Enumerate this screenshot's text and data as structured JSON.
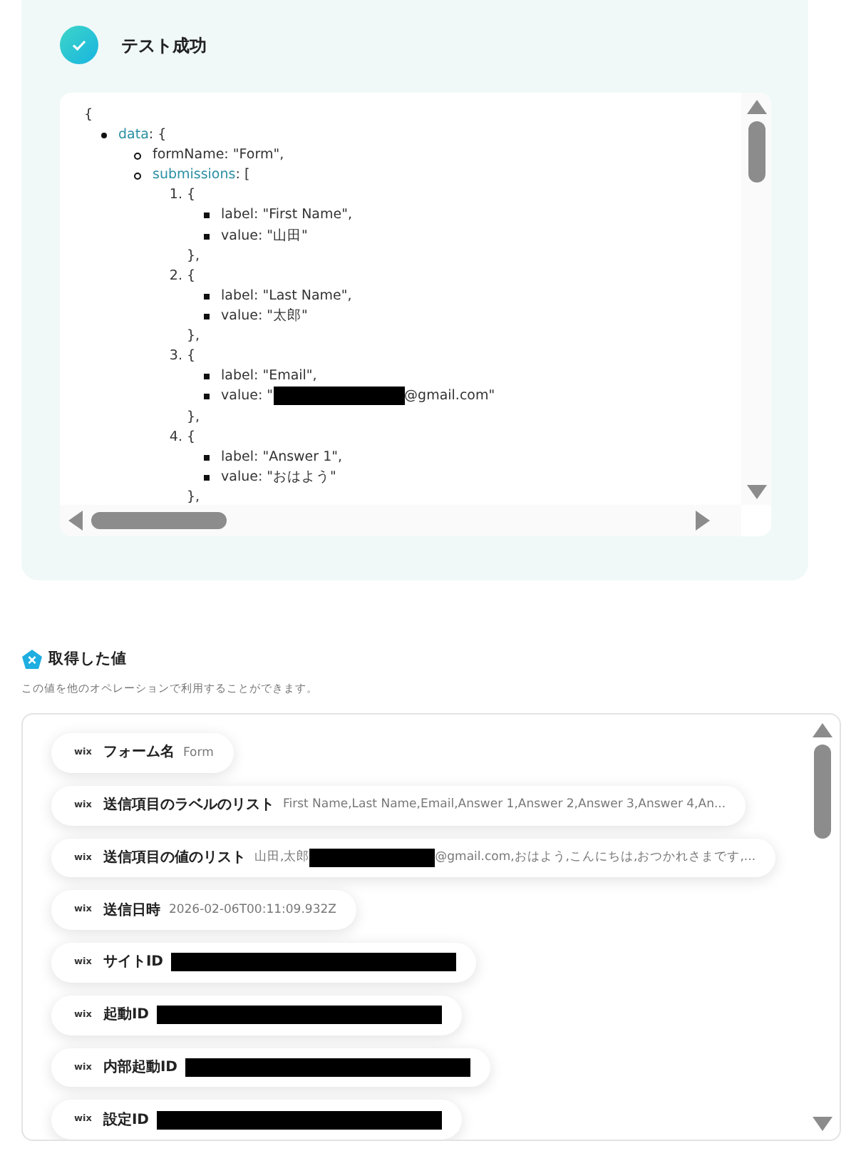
{
  "test_result": {
    "title": "テスト成功",
    "success": true
  },
  "json_view": {
    "text": "{",
    "children": [
      {
        "kind": "disc",
        "key": "data",
        "text": ": {",
        "children": [
          {
            "kind": "circle",
            "text": "formName: \"Form\","
          },
          {
            "kind": "circle",
            "key": "submissions",
            "text": ": [",
            "children": [
              {
                "kind": "number",
                "number": "1.",
                "text": "{",
                "close": "},",
                "children": [
                  {
                    "kind": "square",
                    "text": "label: \"First Name\","
                  },
                  {
                    "kind": "square",
                    "text": "value: \"山田\""
                  }
                ]
              },
              {
                "kind": "number",
                "number": "2.",
                "text": "{",
                "close": "},",
                "children": [
                  {
                    "kind": "square",
                    "text": "label: \"Last Name\","
                  },
                  {
                    "kind": "square",
                    "text": "value: \"太郎\""
                  }
                ]
              },
              {
                "kind": "number",
                "number": "3.",
                "text": "{",
                "close": "},",
                "children": [
                  {
                    "kind": "square",
                    "text": "label: \"Email\","
                  },
                  {
                    "kind": "square",
                    "text": "value: \"",
                    "redacted": true,
                    "after": "@gmail.com\""
                  }
                ]
              },
              {
                "kind": "number",
                "number": "4.",
                "text": "{",
                "close": "},",
                "children": [
                  {
                    "kind": "square",
                    "text": "label: \"Answer 1\","
                  },
                  {
                    "kind": "square",
                    "text": "value: \"おはよう\""
                  }
                ]
              }
            ]
          }
        ]
      }
    ]
  },
  "values_section": {
    "title": "取得した値",
    "description": "この値を他のオペレーションで利用することができます。",
    "items": [
      {
        "badge": "wix",
        "label": "フォーム名",
        "value": "Form"
      },
      {
        "badge": "wix",
        "label": "送信項目のラベルのリスト",
        "value": "First Name,Last Name,Email,Answer 1,Answer 2,Answer 3,Answer 4,An..."
      },
      {
        "badge": "wix",
        "label": "送信項目の値のリスト",
        "value": "山田,太郎",
        "redacted": true,
        "after": "@gmail.com,おはよう,こんにちは,おつかれさまです,..."
      },
      {
        "badge": "wix",
        "label": "送信日時",
        "value": "2026-02-06T00:11:09.932Z"
      },
      {
        "badge": "wix",
        "label": "サイトID",
        "redacted": true
      },
      {
        "badge": "wix",
        "label": "起動ID",
        "redacted": true
      },
      {
        "badge": "wix",
        "label": "内部起動ID",
        "redacted": true
      },
      {
        "badge": "wix",
        "label": "設定ID",
        "redacted": true
      }
    ]
  }
}
